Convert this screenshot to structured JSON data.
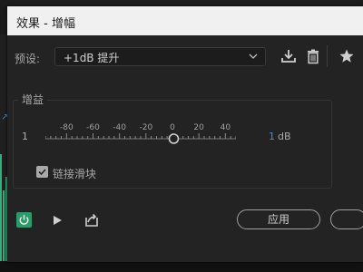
{
  "window": {
    "title": "效果 - 增幅"
  },
  "preset": {
    "label": "预设:",
    "value": "+1dB 提升"
  },
  "gain": {
    "group_label": "增益",
    "channel_number": "1",
    "scale_labels": [
      "-80",
      "-60",
      "-40",
      "-20",
      "0",
      "20",
      "40"
    ],
    "scale_min": -96,
    "scale_max": 48,
    "value": "1",
    "unit": "dB",
    "link_sliders": {
      "label": "链接滑块",
      "checked": true
    }
  },
  "footer": {
    "apply_label": "应用"
  },
  "colors": {
    "accent": "#3a8ee6",
    "power_on": "#2d9a6b",
    "dialog_bg": "#232323",
    "titlebar_bg": "#f0f0f0"
  },
  "icons": {
    "save": "download-icon",
    "delete": "trash-icon",
    "favorite": "star-icon",
    "dropdown": "chevron-down-icon",
    "power": "power-icon",
    "play": "play-icon",
    "export": "export-icon",
    "check": "checkmark-icon",
    "marker": "marker-arrow-icon"
  }
}
